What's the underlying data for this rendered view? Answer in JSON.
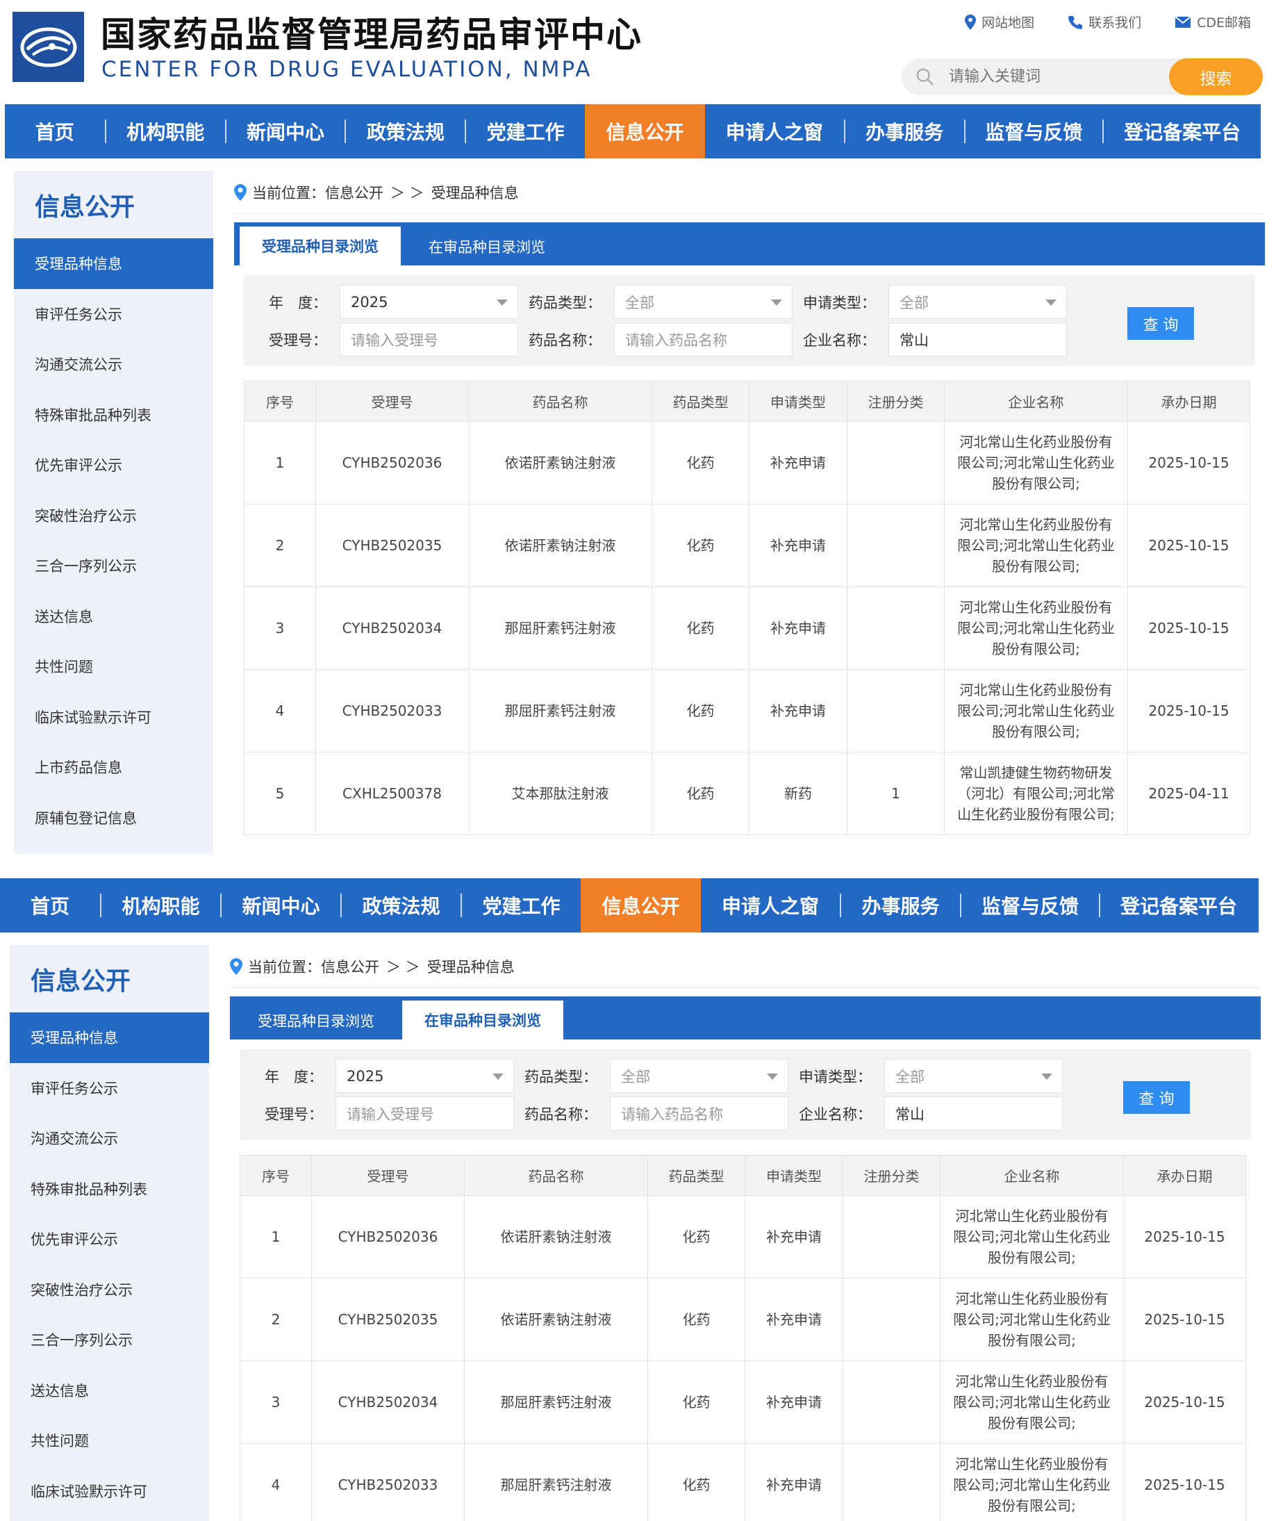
{
  "header": {
    "title_cn": "国家药品监督管理局药品审评中心",
    "title_en": "CENTER FOR DRUG EVALUATION, NMPA",
    "links": [
      "网站地图",
      "联系我们",
      "CDE邮箱"
    ],
    "search_placeholder": "请输入关键词",
    "search_button": "搜索"
  },
  "nav": [
    "首页",
    "机构职能",
    "新闻中心",
    "政策法规",
    "党建工作",
    "信息公开",
    "申请人之窗",
    "办事服务",
    "监督与反馈",
    "登记备案平台"
  ],
  "sidebar": {
    "title": "信息公开",
    "items": [
      "受理品种信息",
      "审评任务公示",
      "沟通交流公示",
      "特殊审批品种列表",
      "优先审评公示",
      "突破性治疗公示",
      "三合一序列公示",
      "送达信息",
      "共性问题",
      "临床试验默示许可",
      "上市药品信息",
      "原辅包登记信息"
    ]
  },
  "breadcrumb": {
    "prefix": "当前位置：信息公开",
    "sep": "＞ ＞",
    "current": "受理品种信息"
  },
  "tabs": [
    "受理品种目录浏览",
    "在审品种目录浏览"
  ],
  "filters": {
    "year_label": "年　度：",
    "year_value": "2025",
    "drug_type_label": "药品类型：",
    "drug_type_value": "全部",
    "apply_type_label": "申请类型：",
    "apply_type_value": "全部",
    "accept_no_label": "受理号：",
    "accept_no_placeholder": "请输入受理号",
    "drug_name_label": "药品名称：",
    "drug_name_placeholder": "请输入药品名称",
    "company_label": "企业名称：",
    "company_value": "常山",
    "query_button": "查 询"
  },
  "table": {
    "headers": [
      "序号",
      "受理号",
      "药品名称",
      "药品类型",
      "申请类型",
      "注册分类",
      "企业名称",
      "承办日期"
    ],
    "rows": [
      [
        "1",
        "CYHB2502036",
        "依诺肝素钠注射液",
        "化药",
        "补充申请",
        "",
        "河北常山生化药业股份有限公司;河北常山生化药业股份有限公司;",
        "2025-10-15"
      ],
      [
        "2",
        "CYHB2502035",
        "依诺肝素钠注射液",
        "化药",
        "补充申请",
        "",
        "河北常山生化药业股份有限公司;河北常山生化药业股份有限公司;",
        "2025-10-15"
      ],
      [
        "3",
        "CYHB2502034",
        "那屈肝素钙注射液",
        "化药",
        "补充申请",
        "",
        "河北常山生化药业股份有限公司;河北常山生化药业股份有限公司;",
        "2025-10-15"
      ],
      [
        "4",
        "CYHB2502033",
        "那屈肝素钙注射液",
        "化药",
        "补充申请",
        "",
        "河北常山生化药业股份有限公司;河北常山生化药业股份有限公司;",
        "2025-10-15"
      ],
      [
        "5",
        "CXHL2500378",
        "艾本那肽注射液",
        "化药",
        "新药",
        "1",
        "常山凯捷健生物药物研发（河北）有限公司;河北常山生化药业股份有限公司;",
        "2025-04-11"
      ]
    ]
  },
  "colors": {
    "blue": "#2468c6",
    "orange": "#f07f28",
    "search_orange": "#f7a023",
    "query_blue": "#2f8cf0"
  },
  "icons": [
    "logo-icon",
    "map-pin-icon",
    "phone-icon",
    "mail-icon",
    "search-icon",
    "location-pin-icon",
    "caret-down-icon"
  ]
}
